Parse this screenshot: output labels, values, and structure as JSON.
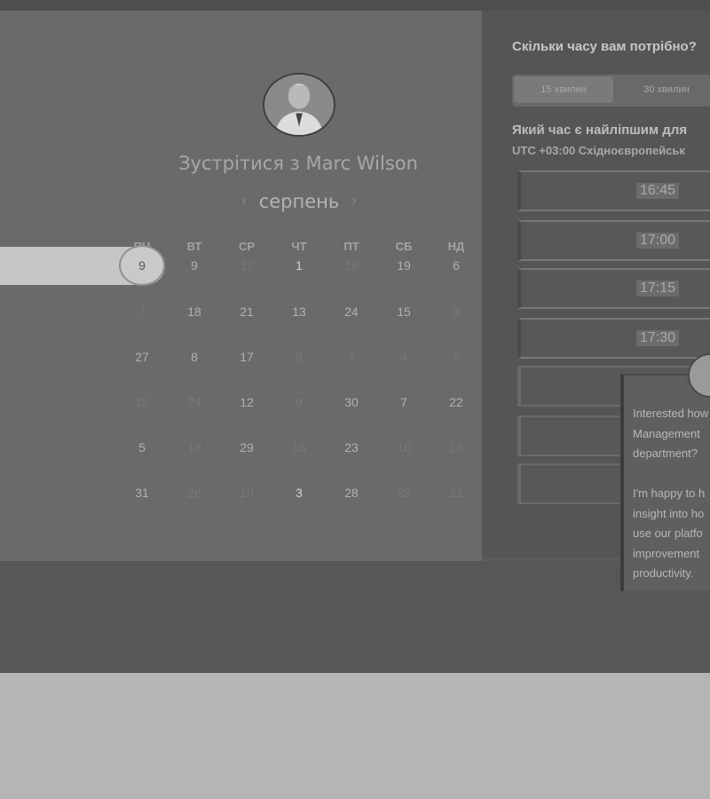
{
  "header": {
    "title": "Зустрітися з Marc Wilson"
  },
  "calendar": {
    "month": "серпень",
    "prev_icon": "chevron-left-icon",
    "next_icon": "chevron-right-icon",
    "weekdays": [
      "ПН",
      "ВТ",
      "СР",
      "ЧТ",
      "ПТ",
      "СБ",
      "НД"
    ],
    "rows": [
      [
        "9",
        "9",
        "17",
        "1",
        "18",
        "19",
        "6"
      ],
      [
        "7",
        "18",
        "21",
        "13",
        "24",
        "15",
        "3"
      ],
      [
        "27",
        "8",
        "17",
        "9",
        "3",
        "4",
        "6"
      ],
      [
        "15",
        "24",
        "12",
        "9",
        "30",
        "7",
        "22"
      ],
      [
        "5",
        "18",
        "29",
        "16",
        "23",
        "10",
        "16"
      ],
      [
        "31",
        "26",
        "10",
        "3",
        "28",
        "29",
        "21"
      ]
    ],
    "selected": "9"
  },
  "booking": {
    "duration_question": "Скільки часу вам потрібно?",
    "durations": [
      "15 хвилин",
      "30 хвилин"
    ],
    "time_question": "Який час є найліпшим для",
    "timezone": "UTC +03:00 Східноєвропейськ",
    "slots": [
      "16:45",
      "17:00",
      "17:15",
      "17:30"
    ]
  },
  "chat": {
    "message": "Interested how\nManagement\ndepartment?\n\nI'm happy to h\ninsight into ho\nuse our platfo\nimprovement\nproductivity."
  },
  "colors": {
    "overlay": "#5b5b5b",
    "selected": "#c6c6c6"
  }
}
